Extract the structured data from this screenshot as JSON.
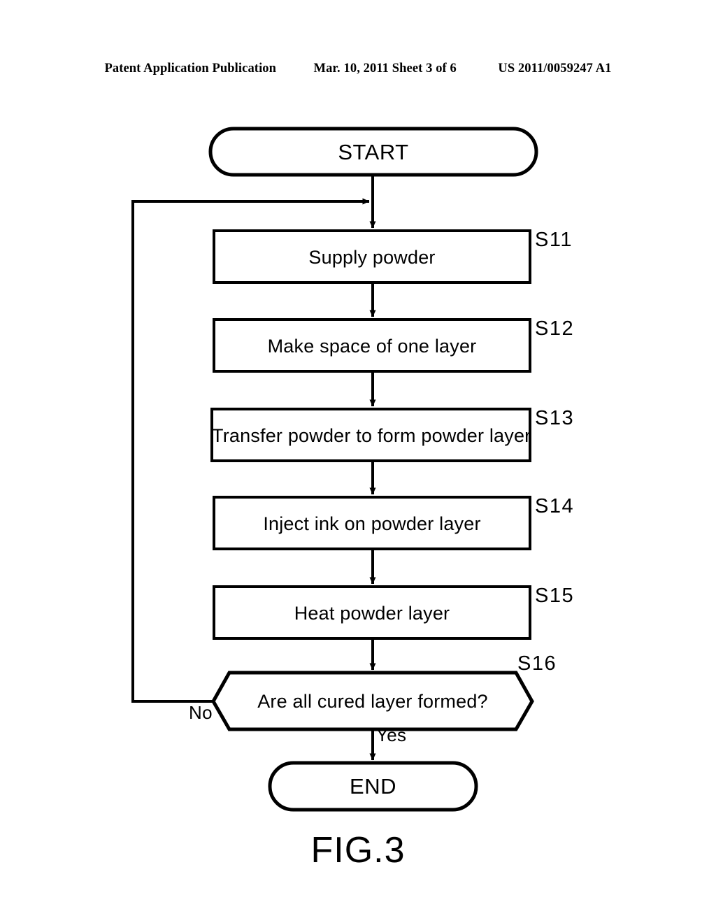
{
  "header": {
    "publication": "Patent Application Publication",
    "date_sheet": "Mar. 10, 2011  Sheet 3 of 6",
    "patent_number": "US 2011/0059247 A1"
  },
  "figure": {
    "caption": "FIG.3",
    "line_color": "#000000",
    "fill_color": "#ffffff"
  },
  "flowchart": {
    "start": {
      "label": "START"
    },
    "end": {
      "label": "END"
    },
    "steps": [
      {
        "tag": "S11",
        "label": "Supply powder"
      },
      {
        "tag": "S12",
        "label": "Make space of one layer"
      },
      {
        "tag": "S13",
        "label": "Transfer powder to form powder layer"
      },
      {
        "tag": "S14",
        "label": "Inject ink on powder layer"
      },
      {
        "tag": "S15",
        "label": "Heat powder layer"
      }
    ],
    "decision": {
      "tag": "S16",
      "label": "Are all cured layer formed?",
      "branch_no": "No",
      "branch_yes": "Yes"
    }
  }
}
